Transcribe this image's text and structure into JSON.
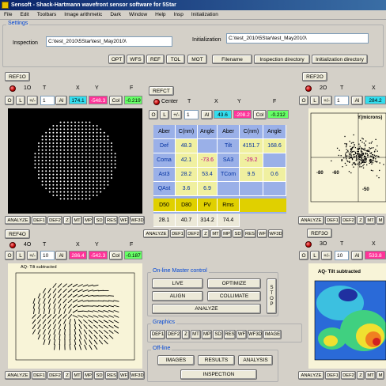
{
  "window": {
    "title": "Sensoft - Shack-Hartmann wavefront sensor software for 5Star"
  },
  "menu": [
    "File",
    "Edit",
    "Toolbars",
    "Image arithmetic",
    "Dark",
    "Window",
    "Help",
    "Insp",
    "Initialization"
  ],
  "settings": {
    "group_title": "Settings",
    "inspection_label": "Inspection",
    "inspection_value": "C:\\test_2010\\5Star\\test_May2010\\",
    "initialization_label": "Initialization",
    "initialization_value": "C:\\test_2010\\5Star\\test_May2010\\",
    "buttons": [
      "OPT",
      "WFS",
      "REF",
      "TOL",
      "MOT",
      "Filename",
      "Inspection directory",
      "Initialization directory"
    ]
  },
  "headers": {
    "t": "T",
    "x": "X",
    "y": "Y",
    "f": "F",
    "center": "Center"
  },
  "panel_1o": {
    "ref_label": "REF1O",
    "id": "1O",
    "btn_o": "O",
    "btn_l": "L",
    "btn_pm": "+/-",
    "t_value": "1",
    "al": "Al",
    "x_value": "174.1",
    "y_value": "-548.3",
    "col": "Col",
    "f_value": "-0.219",
    "bottom_buttons": [
      "ANALYZE",
      "DEF1",
      "DEF2",
      "Z",
      "MT",
      "MP",
      "SD",
      "RES",
      "WF",
      "WF3D"
    ]
  },
  "panel_fct": {
    "ref_label": "REFCT",
    "btn_o": "O",
    "btn_l": "L",
    "btn_pm": "+/-",
    "t_value": "1",
    "al": "Al",
    "x_value": "43.6",
    "y_value": "-208.2",
    "col": "Col",
    "f_value": "-0.212",
    "bottom_buttons": [
      "ANALYZE",
      "DEF1",
      "DEF2",
      "Z",
      "MT",
      "MP",
      "SD",
      "RES",
      "WF",
      "WF3D"
    ]
  },
  "aberrations": {
    "header": [
      "Aber",
      "C(nm)",
      "Angle",
      "Aber",
      "C(nm)",
      "Angle"
    ],
    "rows": [
      [
        "Def",
        "48.3",
        "",
        "Tilt",
        "4151.7",
        "168.6"
      ],
      [
        "Coma",
        "42.1",
        "-73.6",
        "SA3",
        "-29.2",
        ""
      ],
      [
        "Ast3",
        "28.2",
        "53.4",
        "TCom",
        "9.5",
        "0.6"
      ],
      [
        "QAst",
        "3.6",
        "6.9",
        "",
        "",
        ""
      ]
    ],
    "summary_header": [
      "D50",
      "D80",
      "PV",
      "Rms"
    ],
    "summary_values": [
      "28.1",
      "40.7",
      "314.2",
      "74.4"
    ]
  },
  "panel_2o": {
    "ref_label": "REF2O",
    "id": "2O",
    "btn_o": "O",
    "btn_l": "L",
    "btn_pm": "+/-",
    "t_value": "1",
    "al": "Al",
    "x_value": "284.2",
    "plot_title": "Y(microns)",
    "axis_ticks": [
      "-80",
      "-60",
      "50",
      "-50"
    ],
    "bottom_buttons": [
      "ANALYZE",
      "DEF1",
      "DEF2",
      "Z",
      "MT",
      "M"
    ]
  },
  "panel_4o": {
    "ref_label": "REF4O",
    "id": "4O",
    "btn_o": "O",
    "btn_l": "L",
    "btn_pm": "+/-",
    "t_value": "10",
    "al": "Al",
    "x_value": "286.4",
    "y_value": "-542.3",
    "col": "Col",
    "f_value": "-0.187",
    "plot_title": "AQ- Tilt subtracted",
    "bottom_buttons": [
      "ANALYZE",
      "DEF1",
      "DEF2",
      "Z",
      "MT",
      "MP",
      "SD",
      "RES",
      "WF",
      "WF3D"
    ]
  },
  "panel_3o": {
    "ref_label": "REF3O",
    "id": "3O",
    "btn_o": "O",
    "btn_l": "L",
    "btn_pm": "+/-",
    "t_value": "10",
    "al": "Al",
    "x_value": "533.8",
    "plot_title": "AQ- Tilt subtracted",
    "bottom_buttons": [
      "ANALYZE",
      "DEF1",
      "DEF2",
      "Z",
      "MT",
      "M"
    ]
  },
  "master": {
    "group_title": "On-line Master control",
    "live": "LIVE",
    "optimize": "OPTIMIZE",
    "align": "ALIGN",
    "collimate": "COLLIMATE",
    "analyze": "ANALYZE",
    "stop": "STOP"
  },
  "graphics": {
    "group_title": "Graphics",
    "buttons": [
      "DEF1",
      "DEF2",
      "Z",
      "MT",
      "MP",
      "SD",
      "RES",
      "WF",
      "WF3D",
      "IMAGE"
    ]
  },
  "offline": {
    "group_title": "Off-line",
    "images": "IMAGES",
    "results": "RESULTS",
    "analysis": "ANALYSIS",
    "inspection": "INSPECTION"
  },
  "colors": {
    "pink": "#ff3399",
    "green": "#66ff66",
    "cyan": "#33ddee",
    "blue_table": "#9ab0e8",
    "yellow_row": "#e0d000"
  }
}
